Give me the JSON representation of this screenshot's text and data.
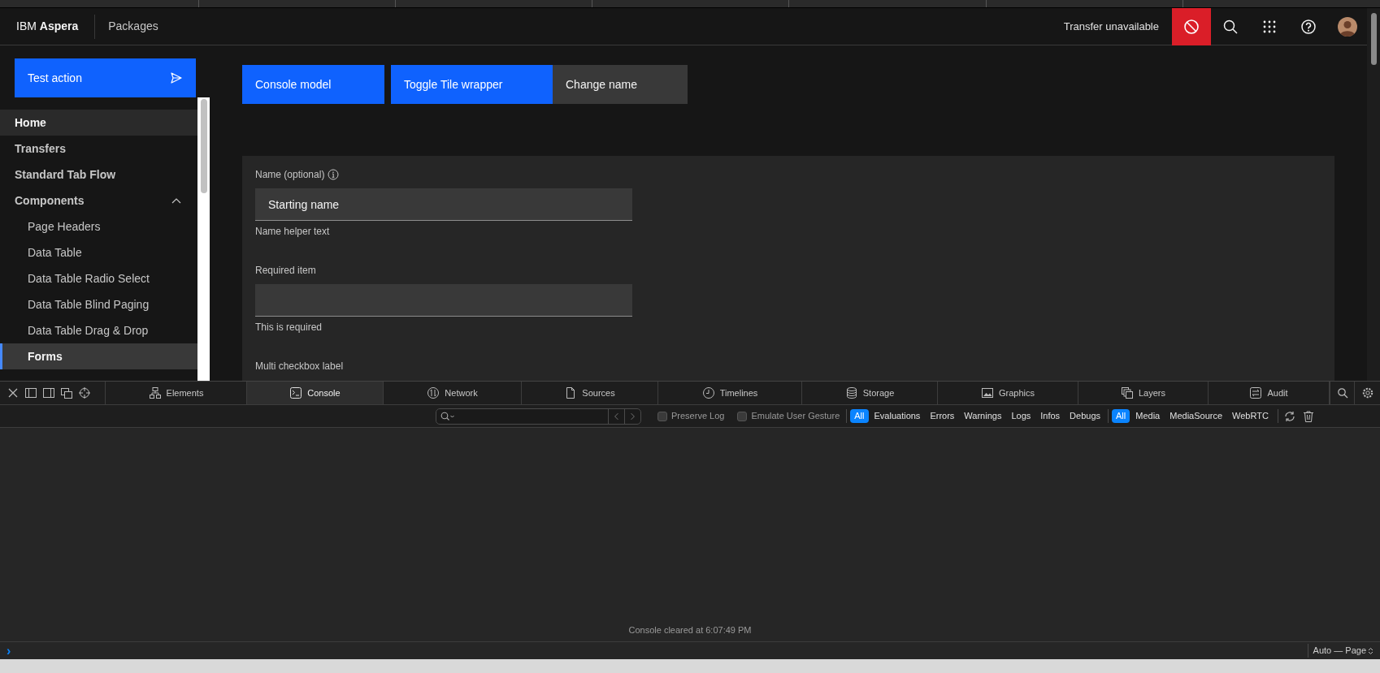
{
  "header": {
    "brand": "IBM **Aspera**",
    "product": "Packages",
    "transfer_status": "Transfer unavailable"
  },
  "sidebar": {
    "action_button": "Test action",
    "items": [
      {
        "label": "Home",
        "selected": false,
        "hovered": true
      },
      {
        "label": "Transfers",
        "selected": false,
        "hovered": false
      },
      {
        "label": "Standard Tab Flow",
        "selected": false,
        "hovered": false
      },
      {
        "label": "Components",
        "selected": false,
        "hovered": false,
        "expanded": true,
        "children": [
          {
            "label": "Page Headers",
            "selected": false,
            "hovered": false
          },
          {
            "label": "Data Table",
            "selected": false,
            "hovered": false
          },
          {
            "label": "Data Table Radio Select",
            "selected": false,
            "hovered": false
          },
          {
            "label": "Data Table Blind Paging",
            "selected": false,
            "hovered": false
          },
          {
            "label": "Data Table Drag & Drop",
            "selected": false,
            "hovered": false
          },
          {
            "label": "Forms",
            "selected": true,
            "hovered": false
          }
        ]
      }
    ]
  },
  "toolbar_buttons": [
    {
      "label": "Console model",
      "kind": "primary"
    },
    {
      "label": "Toggle Tile wrapper",
      "kind": "primary"
    },
    {
      "label": "Change name",
      "kind": "secondary"
    }
  ],
  "form": {
    "fields": [
      {
        "kind": "text",
        "label": "Name (optional)",
        "info": true,
        "value": "Starting name",
        "helper": "Name helper text"
      },
      {
        "kind": "text",
        "label": "Required item",
        "helper": "This is required"
      },
      {
        "kind": "group",
        "label": "Multi checkbox label"
      }
    ]
  },
  "devtools": {
    "tabs": [
      {
        "label": "Elements",
        "selected": false
      },
      {
        "label": "Console",
        "selected": true
      },
      {
        "label": "Network",
        "selected": false
      },
      {
        "label": "Sources",
        "selected": false
      },
      {
        "label": "Timelines",
        "selected": false
      },
      {
        "label": "Storage",
        "selected": false
      },
      {
        "label": "Graphics",
        "selected": false
      },
      {
        "label": "Layers",
        "selected": false
      },
      {
        "label": "Audit",
        "selected": false
      }
    ],
    "options": [
      {
        "label": "Preserve Log",
        "checked": false
      },
      {
        "label": "Emulate User Gesture",
        "checked": false
      }
    ],
    "level_filters": [
      {
        "label": "All",
        "selected": true
      },
      {
        "label": "Evaluations",
        "selected": false
      },
      {
        "label": "Errors",
        "selected": false
      },
      {
        "label": "Warnings",
        "selected": false
      },
      {
        "label": "Logs",
        "selected": false
      },
      {
        "label": "Infos",
        "selected": false
      },
      {
        "label": "Debugs",
        "selected": false
      }
    ],
    "source_filters": [
      {
        "label": "All",
        "selected": true
      },
      {
        "label": "Media",
        "selected": false
      },
      {
        "label": "MediaSource",
        "selected": false
      },
      {
        "label": "WebRTC",
        "selected": false
      }
    ],
    "messages": [
      "Console cleared at 6:07:49 PM"
    ],
    "prompt": "›",
    "execution_context": "Auto — Page"
  }
}
